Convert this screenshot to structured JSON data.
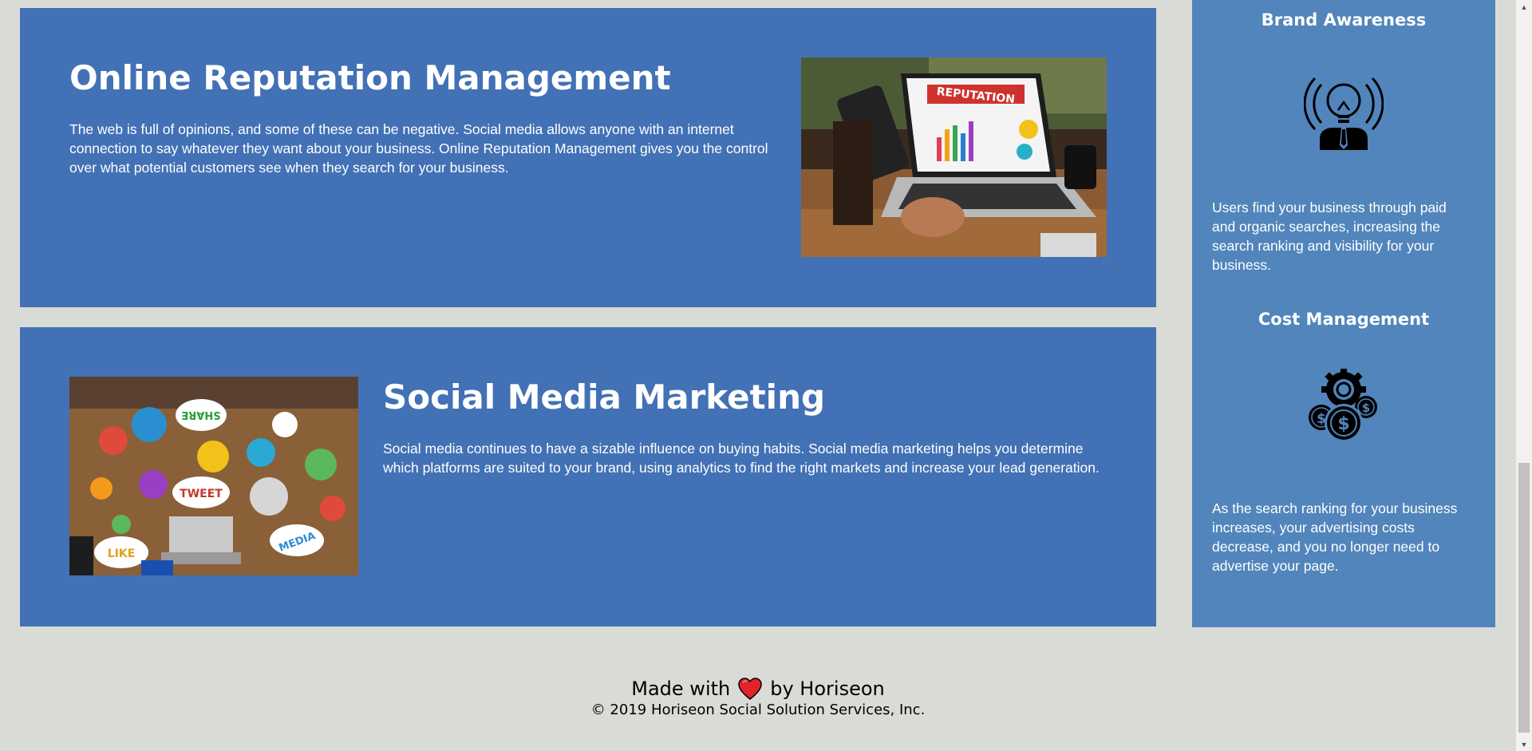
{
  "cards": {
    "orm": {
      "title": "Online Reputation Management",
      "text": "The web is full of opinions, and some of these can be negative. Social media allows anyone with an internet connection to say whatever they want about your business. Online Reputation Management gives you the control over what potential customers see when they search for your business.",
      "image_label": "REPUTATION"
    },
    "smm": {
      "title": "Social Media Marketing",
      "text": "Social media continues to have a sizable influence on buying habits. Social media marketing helps you determine which platforms are suited to your brand, using analytics to find the right markets and increase your lead generation.",
      "image_labels": [
        "SHARE",
        "TWEET",
        "LIKE",
        "MEDIA"
      ]
    }
  },
  "sidebar": {
    "brand": {
      "title": "Brand Awareness",
      "text": "Users find your business through paid and organic searches, increasing the search ranking and visibility for your business.",
      "icon": "lightbulb-head-icon"
    },
    "cost": {
      "title": "Cost Management",
      "text": "As the search ranking for your business increases, your advertising costs decrease, and you no longer need to advertise your page.",
      "icon": "money-gear-icon"
    }
  },
  "footer": {
    "made_with": "Made with",
    "by": "by Horiseon",
    "copyright": "© 2019 Horiseon Social Solution Services, Inc."
  },
  "colors": {
    "page_bg": "#d9dcd6",
    "card_bg": "#4271b5",
    "sidebar_bg": "#5185bb",
    "heart": "#e0242b"
  }
}
